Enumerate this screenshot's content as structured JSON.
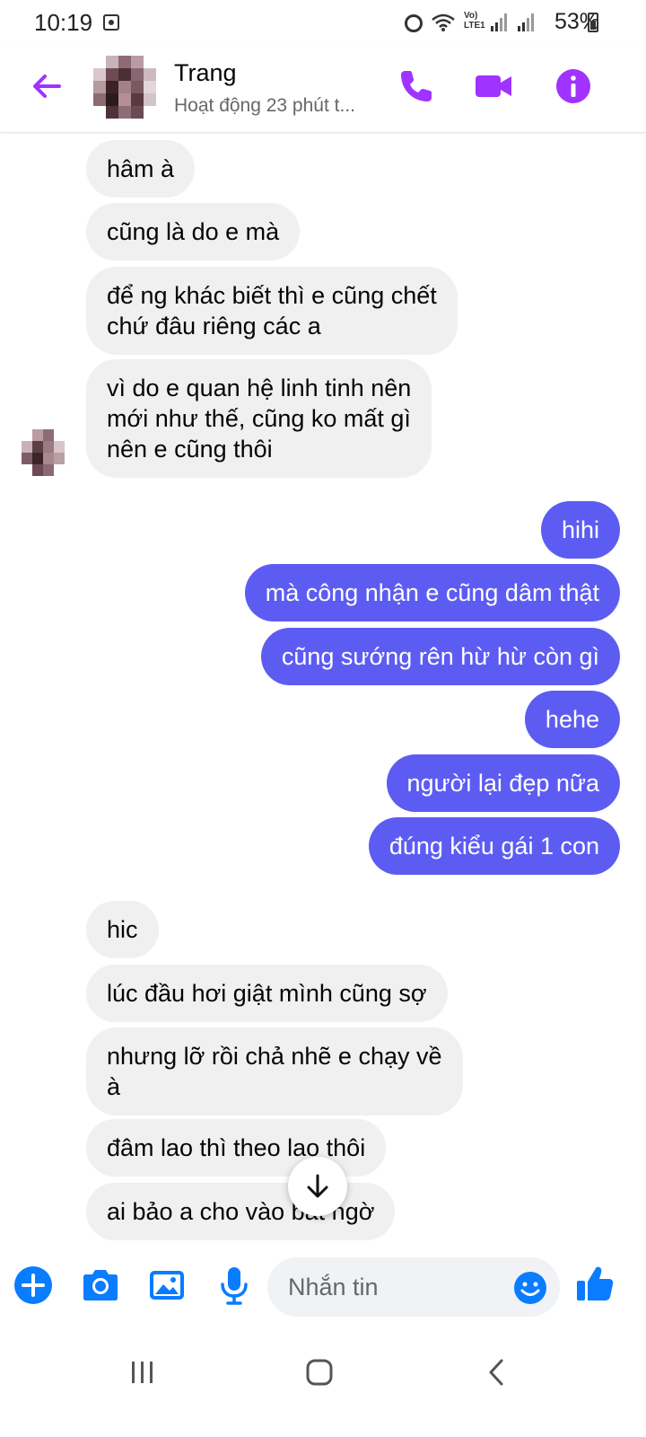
{
  "status_bar": {
    "time": "10:19",
    "network_label": "Vo) LTE1",
    "battery": "53%"
  },
  "header": {
    "contact_name": "Trang",
    "contact_status": "Hoạt động 23 phút t..."
  },
  "messages": [
    {
      "side": "in",
      "text": "hâm à"
    },
    {
      "side": "in",
      "text": "cũng là do e mà"
    },
    {
      "side": "in",
      "text": "để ng khác biết thì e cũng chết\nchứ đâu riêng các a"
    },
    {
      "side": "in",
      "text": "vì do e quan hệ linh tinh nên\nmới như thế, cũng ko mất gì\nnên e cũng thôi"
    },
    {
      "side": "out",
      "text": "hihi"
    },
    {
      "side": "out",
      "text": "mà công nhận e cũng dâm thật"
    },
    {
      "side": "out",
      "text": "cũng sướng rên hừ hừ còn gì"
    },
    {
      "side": "out",
      "text": "hehe"
    },
    {
      "side": "out",
      "text": "người lại đẹp nữa"
    },
    {
      "side": "out",
      "text": "đúng kiểu gái 1 con"
    },
    {
      "side": "in",
      "text": "hic"
    },
    {
      "side": "in",
      "text": "lúc đầu hơi giật mình cũng sợ"
    },
    {
      "side": "in",
      "text": "nhưng lỡ rồi chả nhẽ e chạy về\nà"
    },
    {
      "side": "in",
      "text": "đâm lao thì theo lao thôi"
    },
    {
      "side": "in",
      "text": "ai bảo a cho vào bất ngờ"
    }
  ],
  "composer": {
    "placeholder": "Nhắn tin"
  },
  "colors": {
    "accent": "#a033ff",
    "outgoing_bubble": "#5d5cf2",
    "incoming_bubble": "#f0f0f0",
    "composer_icons": "#0a7cff"
  },
  "icons": {
    "back": "arrow-left-icon",
    "call": "phone-icon",
    "video": "video-camera-icon",
    "info": "info-icon",
    "more": "plus-circle-icon",
    "camera": "camera-icon",
    "gallery": "image-icon",
    "voice": "microphone-icon",
    "emoji": "smiley-icon",
    "like": "thumbs-up-icon",
    "scroll": "arrow-down-icon"
  }
}
